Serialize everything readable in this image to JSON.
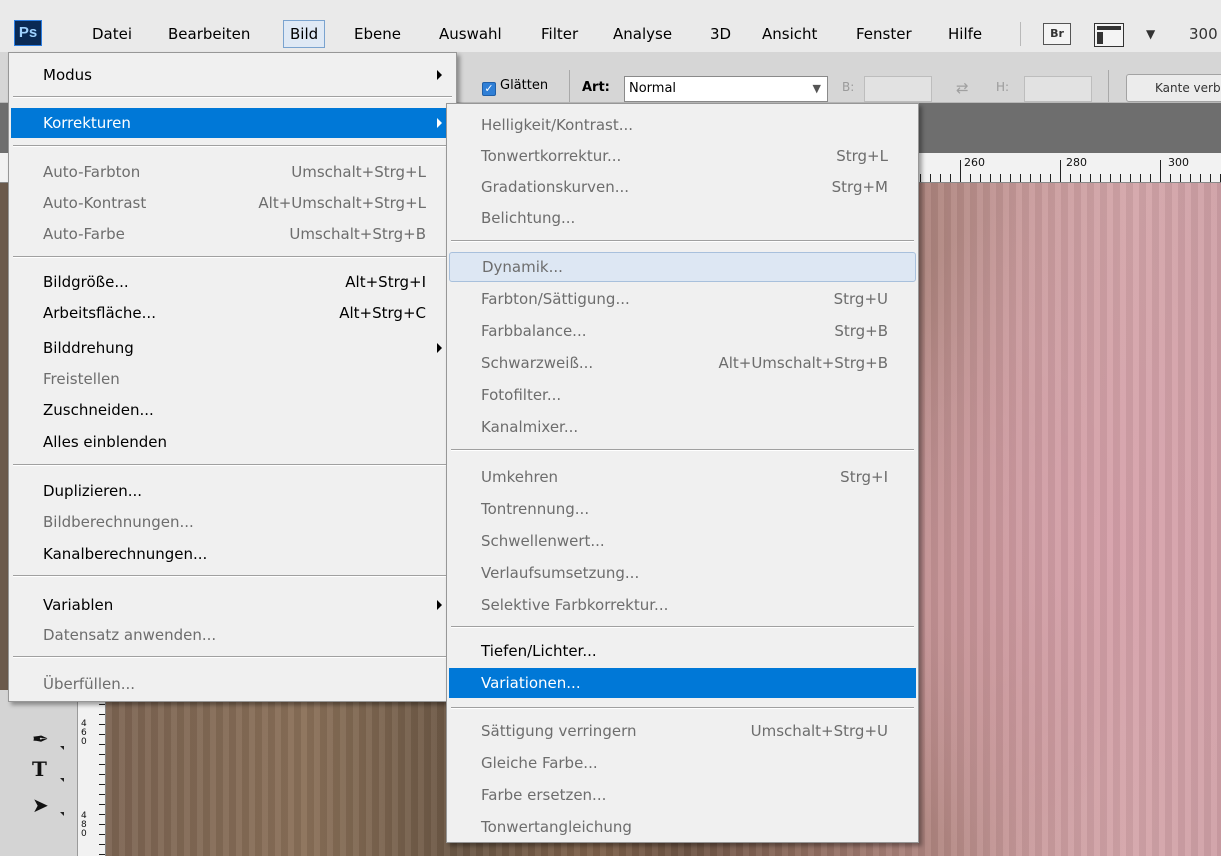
{
  "menubar": {
    "logo": "Ps",
    "items": [
      "Datei",
      "Bearbeiten",
      "Bild",
      "Ebene",
      "Auswahl",
      "Filter",
      "Analyse",
      "3D",
      "Ansicht",
      "Fenster",
      "Hilfe"
    ],
    "bridge_button": "Br",
    "zoom": "300"
  },
  "options": {
    "glaetten": "Glätten",
    "art_label": "Art:",
    "art_value": "Normal",
    "b_label": "B:",
    "h_label": "H:",
    "kante_button": "Kante verbessern..."
  },
  "ruler": {
    "top_labels": [
      "260",
      "280",
      "300"
    ],
    "left_labels": [
      "4\n6\n0",
      "4\n8\n0"
    ]
  },
  "bild_menu": {
    "items": [
      {
        "label": "Modus",
        "shortcut": "",
        "submenu": true,
        "state": "normal"
      },
      {
        "label": "Korrekturen",
        "shortcut": "",
        "submenu": true,
        "state": "highlight"
      },
      {
        "label": "Auto-Farbton",
        "shortcut": "Umschalt+Strg+L",
        "state": "disabled"
      },
      {
        "label": "Auto-Kontrast",
        "shortcut": "Alt+Umschalt+Strg+L",
        "state": "disabled"
      },
      {
        "label": "Auto-Farbe",
        "shortcut": "Umschalt+Strg+B",
        "state": "disabled"
      },
      {
        "label": "Bildgröße...",
        "shortcut": "Alt+Strg+I",
        "state": "normal"
      },
      {
        "label": "Arbeitsfläche...",
        "shortcut": "Alt+Strg+C",
        "state": "normal"
      },
      {
        "label": "Bilddrehung",
        "shortcut": "",
        "submenu": true,
        "state": "normal"
      },
      {
        "label": "Freistellen",
        "shortcut": "",
        "state": "disabled"
      },
      {
        "label": "Zuschneiden...",
        "shortcut": "",
        "state": "normal"
      },
      {
        "label": "Alles einblenden",
        "shortcut": "",
        "state": "normal"
      },
      {
        "label": "Duplizieren...",
        "shortcut": "",
        "state": "normal"
      },
      {
        "label": "Bildberechnungen...",
        "shortcut": "",
        "state": "disabled"
      },
      {
        "label": "Kanalberechnungen...",
        "shortcut": "",
        "state": "normal"
      },
      {
        "label": "Variablen",
        "shortcut": "",
        "submenu": true,
        "state": "normal"
      },
      {
        "label": "Datensatz anwenden...",
        "shortcut": "",
        "state": "disabled"
      },
      {
        "label": "Überfüllen...",
        "shortcut": "",
        "state": "disabled"
      }
    ]
  },
  "korrekturen_menu": {
    "items": [
      {
        "label": "Helligkeit/Kontrast...",
        "shortcut": "",
        "state": "disabled"
      },
      {
        "label": "Tonwertkorrektur...",
        "shortcut": "Strg+L",
        "state": "disabled"
      },
      {
        "label": "Gradationskurven...",
        "shortcut": "Strg+M",
        "state": "disabled"
      },
      {
        "label": "Belichtung...",
        "shortcut": "",
        "state": "disabled"
      },
      {
        "label": "Dynamik...",
        "shortcut": "",
        "state": "hover"
      },
      {
        "label": "Farbton/Sättigung...",
        "shortcut": "Strg+U",
        "state": "disabled"
      },
      {
        "label": "Farbbalance...",
        "shortcut": "Strg+B",
        "state": "disabled"
      },
      {
        "label": "Schwarzweiß...",
        "shortcut": "Alt+Umschalt+Strg+B",
        "state": "disabled"
      },
      {
        "label": "Fotofilter...",
        "shortcut": "",
        "state": "disabled"
      },
      {
        "label": "Kanalmixer...",
        "shortcut": "",
        "state": "disabled"
      },
      {
        "label": "Umkehren",
        "shortcut": "Strg+I",
        "state": "disabled"
      },
      {
        "label": "Tontrennung...",
        "shortcut": "",
        "state": "disabled"
      },
      {
        "label": "Schwellenwert...",
        "shortcut": "",
        "state": "disabled"
      },
      {
        "label": "Verlaufsumsetzung...",
        "shortcut": "",
        "state": "disabled"
      },
      {
        "label": "Selektive Farbkorrektur...",
        "shortcut": "",
        "state": "disabled"
      },
      {
        "label": "Tiefen/Lichter...",
        "shortcut": "",
        "state": "normal"
      },
      {
        "label": "Variationen...",
        "shortcut": "",
        "state": "highlight"
      },
      {
        "label": "Sättigung verringern",
        "shortcut": "Umschalt+Strg+U",
        "state": "disabled"
      },
      {
        "label": "Gleiche Farbe...",
        "shortcut": "",
        "state": "disabled"
      },
      {
        "label": "Farbe ersetzen...",
        "shortcut": "",
        "state": "disabled"
      },
      {
        "label": "Tonwertangleichung",
        "shortcut": "",
        "state": "disabled"
      }
    ]
  },
  "toolbox": {
    "tools": [
      "pen-tool-icon",
      "type-tool-icon",
      "path-selection-tool-icon"
    ]
  },
  "colors": {
    "highlight": "#0078d7",
    "menu_bg": "#f0f0f0",
    "disabled_text": "#6d6d6d"
  }
}
